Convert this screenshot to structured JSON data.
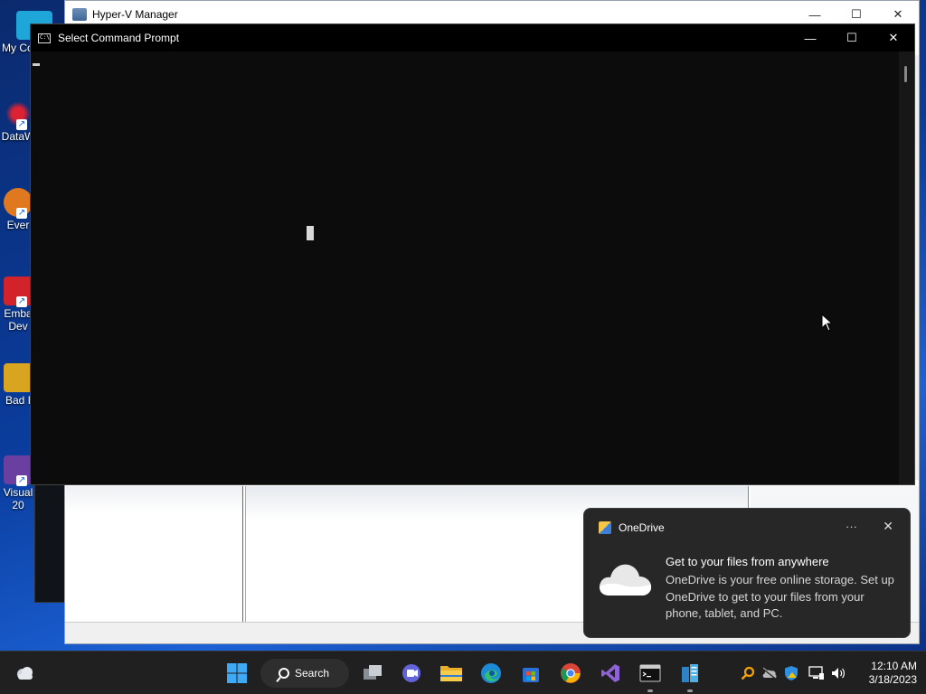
{
  "desktop": {
    "icons": [
      {
        "label": "My Co",
        "icon": "computer-icon"
      },
      {
        "label": "DataW",
        "icon": "datawindow-icon"
      },
      {
        "label": "Ever",
        "icon": "everything-icon"
      },
      {
        "label": "Emba Dev",
        "icon": "embarcadero-icon"
      },
      {
        "label": "Bad I",
        "icon": "bad-icon"
      },
      {
        "label": "Visual 20",
        "icon": "visual-studio-icon"
      }
    ]
  },
  "hyperv": {
    "title": "Hyper-V Manager",
    "icon": "hyperv-icon"
  },
  "cmd": {
    "title": "Select Command Prompt",
    "icon": "cmd-icon"
  },
  "toast": {
    "app": "OneDrive",
    "more": "···",
    "title": "Get to your files from anywhere",
    "body": "OneDrive is your free online storage. Set up OneDrive to get to your files from your phone, tablet, and PC."
  },
  "taskbar": {
    "search_label": "Search",
    "time": "12:10 AM",
    "date": "3/18/2023",
    "pinned": [
      "start-icon",
      "task-view-icon",
      "teams-chat-icon",
      "file-explorer-icon",
      "edge-icon",
      "store-icon",
      "chrome-icon",
      "visual-studio-icon",
      "terminal-icon",
      "hyperv-manager-icon"
    ],
    "tray": [
      "search-tool-icon",
      "onedrive-icon",
      "defender-icon",
      "network-icon",
      "volume-icon"
    ]
  },
  "colors": {
    "cmd_background": "#0c0c0c",
    "toast_background": "#272727",
    "taskbar_background": "#202020"
  }
}
